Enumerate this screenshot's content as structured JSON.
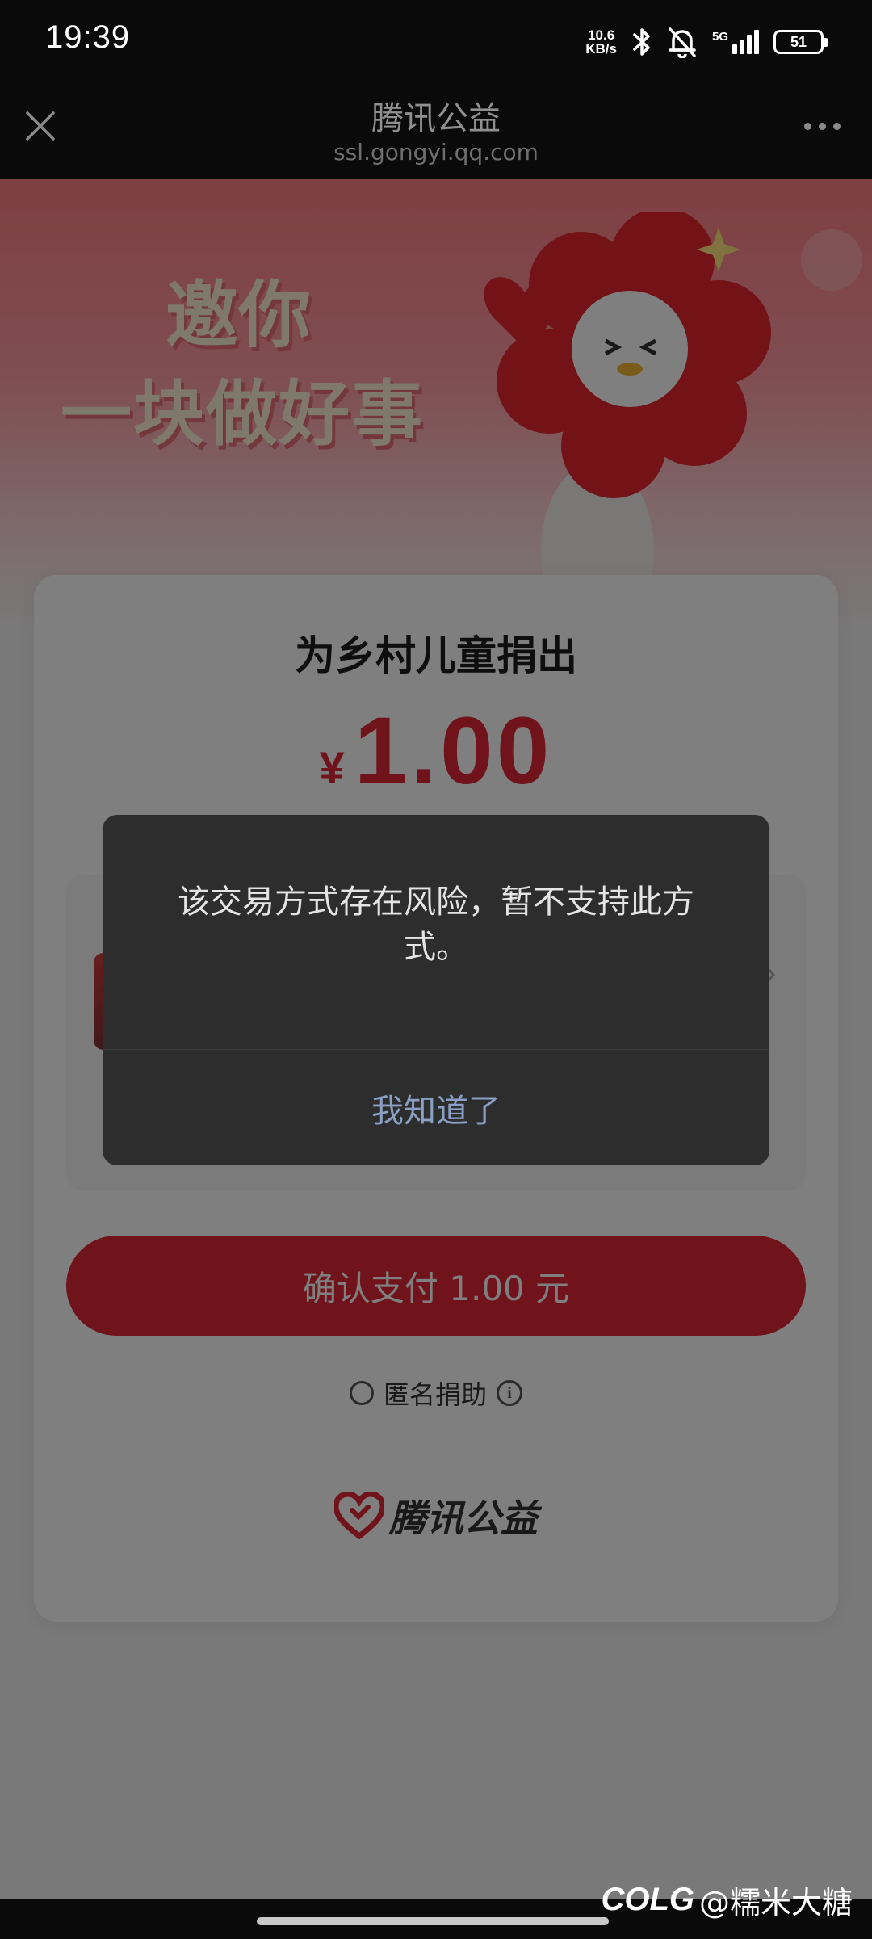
{
  "status_bar": {
    "time": "19:39",
    "net_speed_value": "10.6",
    "net_speed_unit": "KB/s",
    "network_type": "5G",
    "battery_level": "51",
    "icons": [
      "bluetooth-icon",
      "mute-bell-icon",
      "signal-icon",
      "battery-icon"
    ]
  },
  "title_bar": {
    "title": "腾讯公益",
    "url": "ssl.gongyi.qq.com"
  },
  "banner": {
    "line1": "邀你",
    "line2": "一块做好事"
  },
  "card": {
    "title": "为乡村儿童捐出",
    "currency_symbol": "¥",
    "amount": "1.00",
    "pay_button_label": "确认支付 1.00 元",
    "anonymous_label": "匿名捐助",
    "info_glyph": "i"
  },
  "footer": {
    "brand": "腾讯公益"
  },
  "dialog": {
    "message": "该交易方式存在风险，暂不支持此方式。",
    "button_label": "我知道了"
  },
  "watermark": {
    "brand": "COLG",
    "handle": "@糯米大糖"
  },
  "colors": {
    "accent": "#e02737",
    "dialog_bg": "#2d2d2d",
    "dialog_button": "#8a9fc4"
  }
}
